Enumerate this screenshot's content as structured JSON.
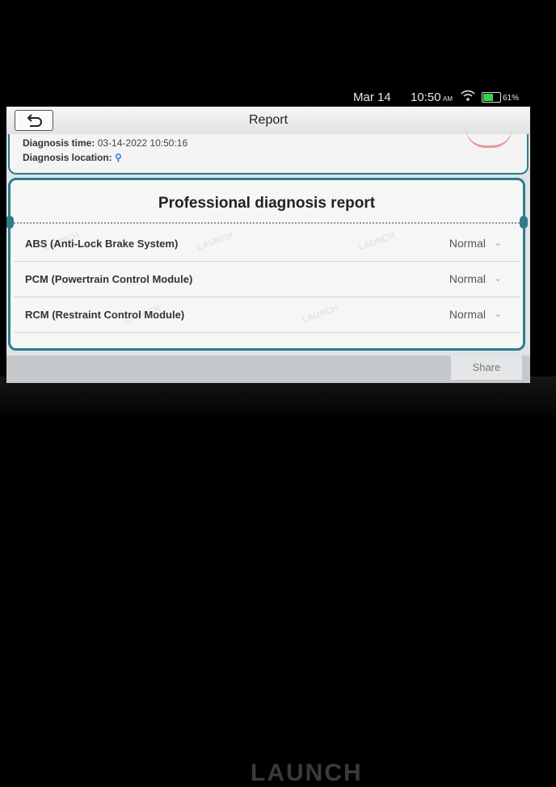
{
  "status_bar": {
    "date": "Mar 14",
    "time": "10:50",
    "ampm": "AM",
    "battery": "61%",
    "battery_level": 0.61
  },
  "header": {
    "title": "Report"
  },
  "info": {
    "time_label": "Diagnosis time:",
    "time_value": "03-14-2022 10:50:16",
    "location_label": "Diagnosis location:"
  },
  "report": {
    "title": "Professional diagnosis report",
    "modules": [
      {
        "name": "ABS (Anti-Lock Brake System)",
        "status": "Normal"
      },
      {
        "name": "PCM (Powertrain Control Module)",
        "status": "Normal"
      },
      {
        "name": "RCM (Restraint Control Module)",
        "status": "Normal"
      }
    ]
  },
  "footer": {
    "share_label": "Share"
  },
  "device": {
    "logo_text": "LAUNCH"
  },
  "icons": {
    "back": "back-arrow-icon",
    "wifi": "wifi-icon",
    "location": "location-pin-icon",
    "chevron": "chevron-down-icon"
  },
  "colors": {
    "accent": "#2e7b8a",
    "battery": "#39d14a",
    "pin": "#2a7de1"
  }
}
